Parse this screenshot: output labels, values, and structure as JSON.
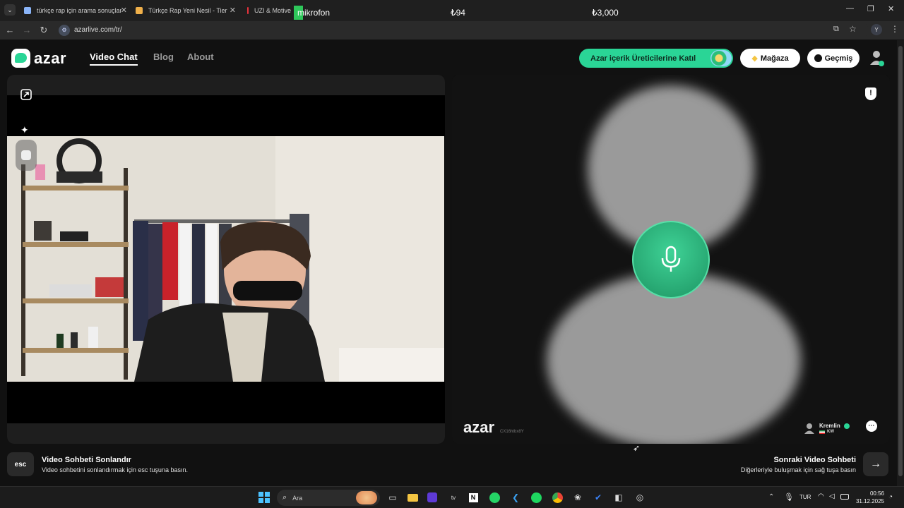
{
  "browser": {
    "tabs": [
      {
        "title": "türkçe rap için arama sonuçları",
        "color": "#8ab4f8"
      },
      {
        "title": "Türkçe Rap Yeni Nesil - Tier List",
        "color": "#f0b04a"
      },
      {
        "title": "UZI & Motive",
        "color": "#e8323c"
      }
    ],
    "overlay_label": "mikrofon",
    "overlay_price_1": "₺94",
    "overlay_price_2": "₺3,000",
    "url": "azarlive.com/tr/"
  },
  "header": {
    "logo_text": "azar",
    "nav": [
      {
        "label": "Video Chat",
        "active": true
      },
      {
        "label": "Blog",
        "active": false
      },
      {
        "label": "About",
        "active": false
      }
    ],
    "creator_button": "Azar içerik Üreticilerine Katıl",
    "store_button": "Mağaza",
    "history_button": "Geçmiş",
    "accent": "#2ad596"
  },
  "partner": {
    "watermark": "azar",
    "watermark_id": "CX16htbx8Y",
    "name": "Kremlin",
    "country": "KW"
  },
  "footer": {
    "esc_key": "esc",
    "end_title": "Video Sohbeti Sonlandır",
    "end_sub": "Video sohbetini sonlandırmak için esc tuşuna basın.",
    "next_title": "Sonraki Video Sohbeti",
    "next_sub": "Diğerleriyle buluşmak için sağ tuşa basın"
  },
  "taskbar": {
    "search_placeholder": "Ara",
    "language": "TUR",
    "time": "00:56",
    "date": "31.12.2025"
  }
}
